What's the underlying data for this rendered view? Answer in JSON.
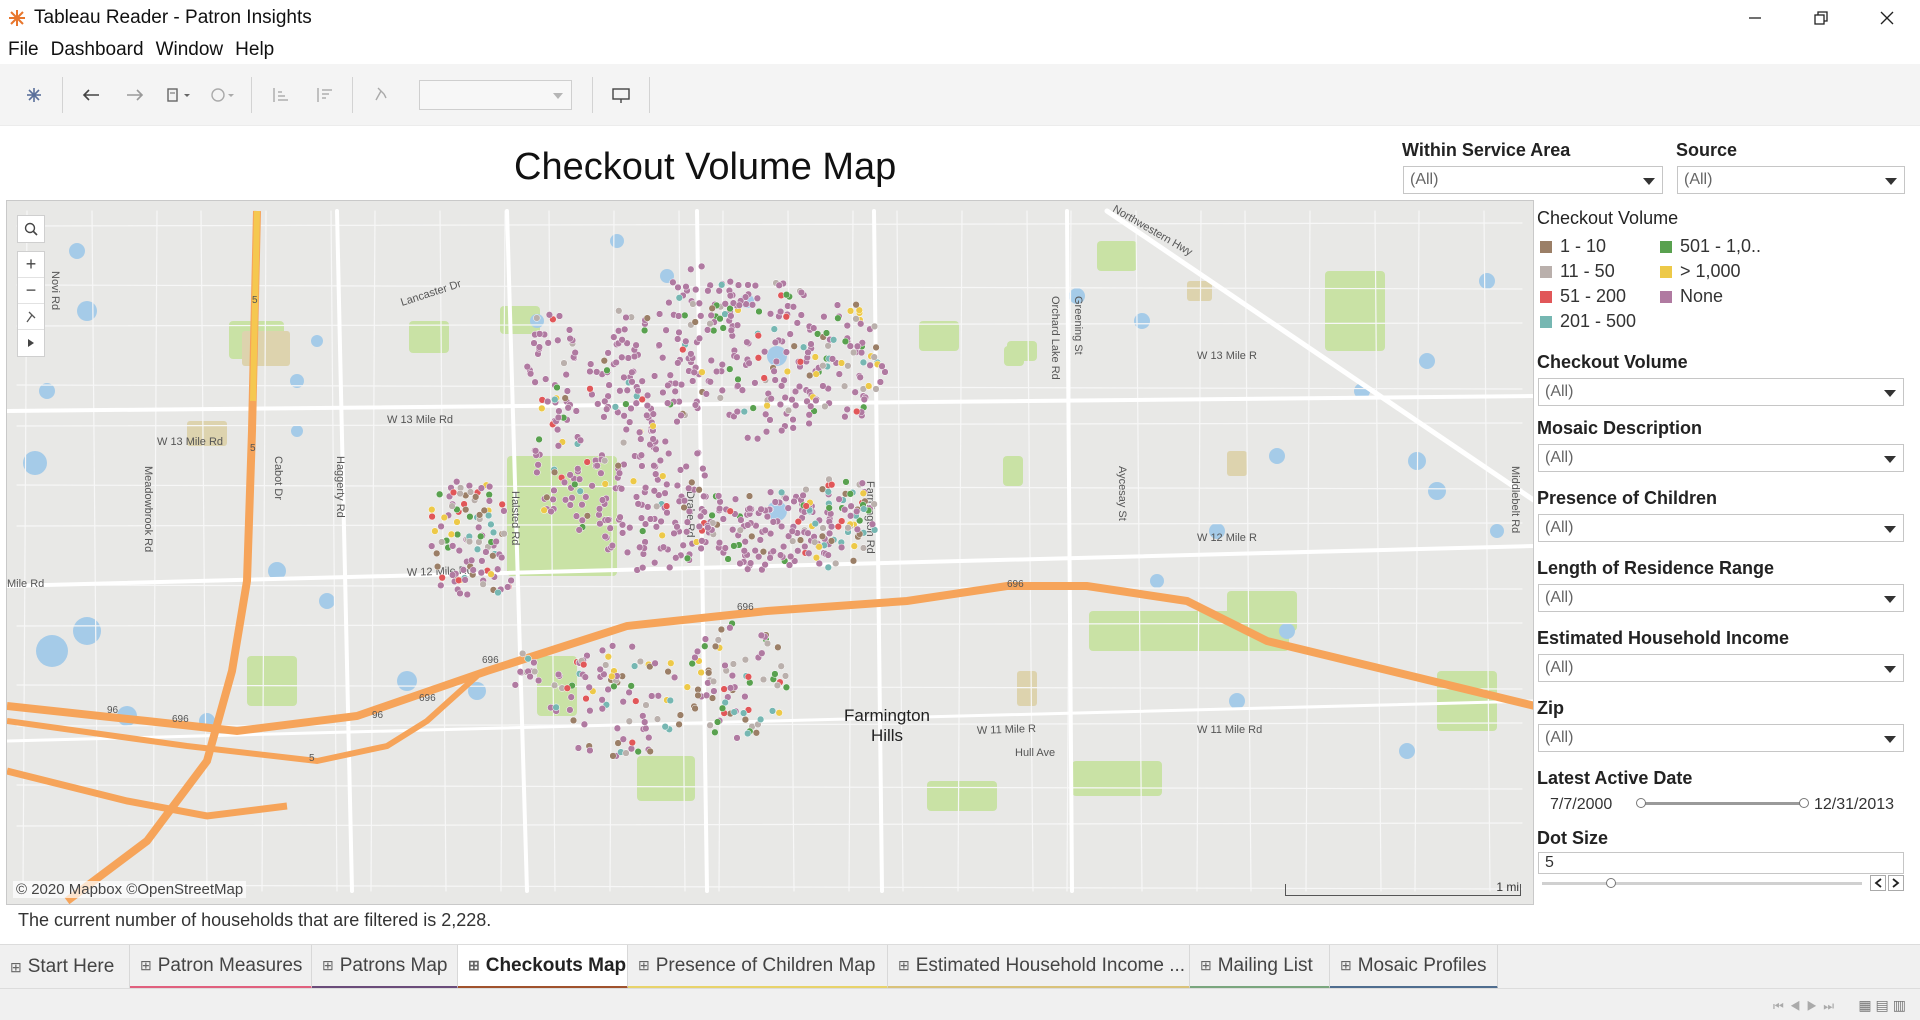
{
  "window": {
    "title": "Tableau Reader - Patron Insights"
  },
  "menu": [
    "File",
    "Dashboard",
    "Window",
    "Help"
  ],
  "dashboard": {
    "title": "Checkout Volume Map",
    "filter_note": "The current number of households that are filtered is 2,228."
  },
  "map": {
    "attribution": "© 2020 Mapbox ©OpenStreetMap",
    "scale_label": "1 mi",
    "road_labels": [
      "W 13 Mile Rd",
      "W 13 Mile Rd",
      "W 13 Mile R",
      "W 12 Mile Rd",
      "W 12 Mile R",
      "W 11 Mile Rd",
      "W 11 Mile R",
      "Mile Rd",
      "Novi Rd",
      "Meadowbrook Rd",
      "Cabot Dr",
      "Haggerty Rd",
      "Halsted Rd",
      "Drake Rd",
      "Farmington Rd",
      "Orchard Lake Rd",
      "Greening St",
      "Middlebelt Rd",
      "Aycesay St",
      "Lancaster Dr",
      "Northwestern Hwy",
      "Hull Ave",
      "5",
      "5",
      "5",
      "696",
      "696",
      "696",
      "696",
      "696",
      "96",
      "96"
    ],
    "place_label_1": "Farmington",
    "place_label_2": "Hills"
  },
  "right_panel": {
    "within_service_area": {
      "label": "Within Service Area",
      "value": "(All)"
    },
    "source": {
      "label": "Source",
      "value": "(All)"
    },
    "legend": {
      "title": "Checkout Volume",
      "items": [
        {
          "label": "1 - 10",
          "color": "#9b7f67"
        },
        {
          "label": "11 - 50",
          "color": "#bab0ac"
        },
        {
          "label": "51 - 200",
          "color": "#e15759"
        },
        {
          "label": "201 - 500",
          "color": "#76b7b2"
        },
        {
          "label": "501 - 1,0..",
          "color": "#59a14f"
        },
        {
          "label": "> 1,000",
          "color": "#edc948"
        },
        {
          "label": "None",
          "color": "#b07aa1"
        }
      ]
    },
    "filters": [
      {
        "label": "Checkout Volume",
        "value": "(All)"
      },
      {
        "label": "Mosaic Description",
        "value": "(All)"
      },
      {
        "label": "Presence of Children",
        "value": "(All)"
      },
      {
        "label": "Length of Residence Range",
        "value": "(All)"
      },
      {
        "label": "Estimated Household Income",
        "value": "(All)"
      },
      {
        "label": "Zip",
        "value": "(All)"
      }
    ],
    "latest_active_date": {
      "label": "Latest Active Date",
      "start": "7/7/2000",
      "end": "12/31/2013"
    },
    "dot_size": {
      "label": "Dot Size",
      "value": "5"
    }
  },
  "tabs": [
    {
      "label": "Start Here",
      "underline": ""
    },
    {
      "label": "Patron Measures",
      "underline": "#e0607e"
    },
    {
      "label": "Patrons Map",
      "underline": "#6b4c7a"
    },
    {
      "label": "Checkouts Map",
      "underline": "#a0522d"
    },
    {
      "label": "Presence of Children Map",
      "underline": "#e8d36b"
    },
    {
      "label": "Estimated Household Income ...",
      "underline": "#d9c27a"
    },
    {
      "label": "Mailing List",
      "underline": "#7aa67e"
    },
    {
      "label": "Mosaic Profiles",
      "underline": "#4f6d8f"
    }
  ]
}
